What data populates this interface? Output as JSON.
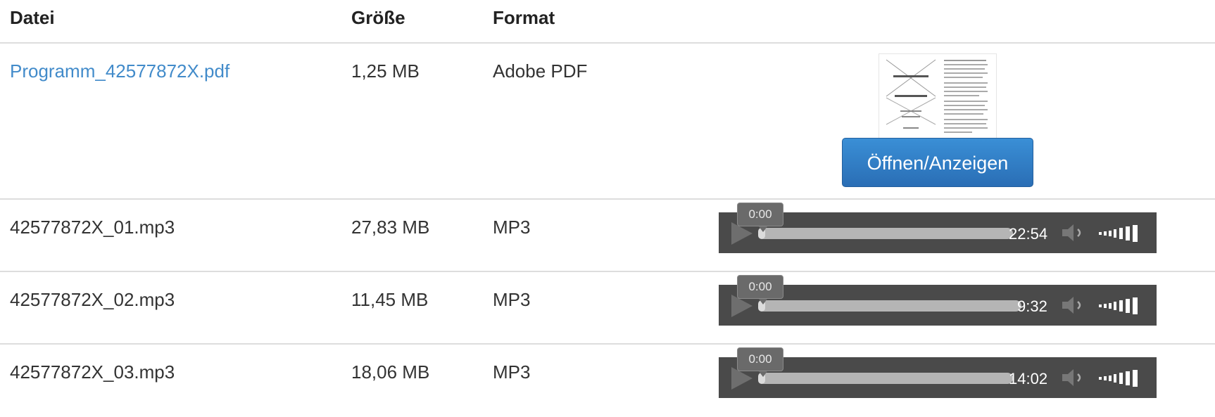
{
  "header": {
    "file": "Datei",
    "size": "Größe",
    "format": "Format"
  },
  "rows": [
    {
      "file": "Programm_42577872X.pdf",
      "size": "1,25 MB",
      "format": "Adobe PDF",
      "button": "Öffnen/Anzeigen"
    },
    {
      "file": "42577872X_01.mp3",
      "size": "27,83 MB",
      "format": "MP3",
      "current": "0:00",
      "duration": "22:54"
    },
    {
      "file": "42577872X_02.mp3",
      "size": "11,45 MB",
      "format": "MP3",
      "current": "0:00",
      "duration": "9:32"
    },
    {
      "file": "42577872X_03.mp3",
      "size": "18,06 MB",
      "format": "MP3",
      "current": "0:00",
      "duration": "14:02"
    }
  ],
  "colors": {
    "link": "#428bca",
    "button": "#2d78c2",
    "player": "#4a4a4a"
  },
  "icons": [
    "play-icon",
    "volume-icon",
    "volume-level-icon",
    "pdf-thumbnail"
  ]
}
